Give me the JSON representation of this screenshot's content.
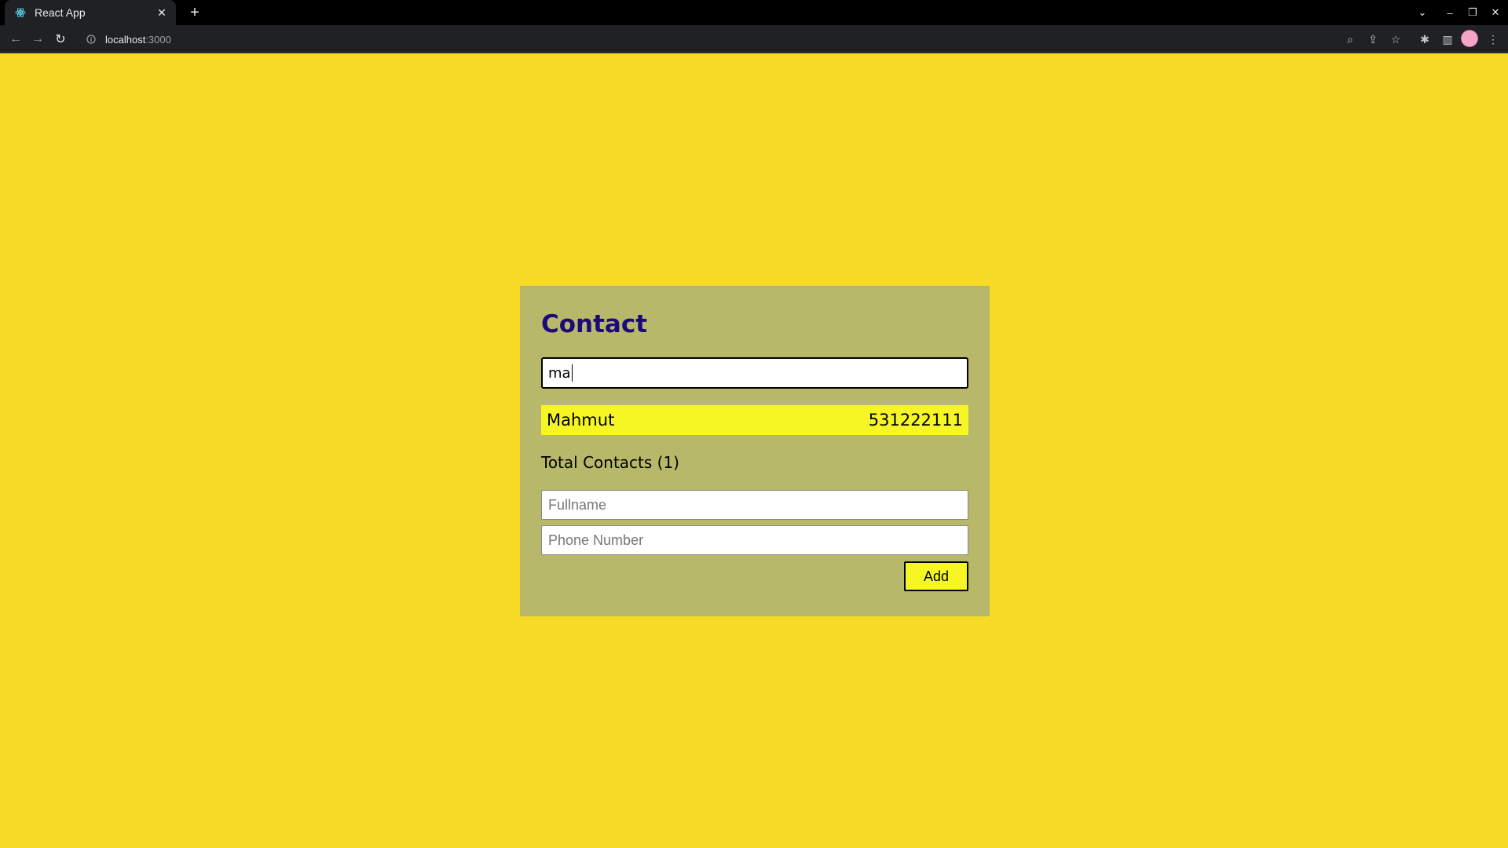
{
  "browser": {
    "tab_title": "React App",
    "url_host": "localhost",
    "url_port": ":3000"
  },
  "app": {
    "heading": "Contact",
    "search_value": "ma",
    "contacts": [
      {
        "name": "Mahmut",
        "phone": "531222111"
      }
    ],
    "total_label": "Total Contacts (1)",
    "fullname_placeholder": "Fullname",
    "phone_placeholder": "Phone Number",
    "add_label": "Add"
  },
  "colors": {
    "page_bg": "#f7db27",
    "card_bg": "#b8b86b",
    "heading": "#1d0a7a",
    "highlight": "#f6f625"
  }
}
